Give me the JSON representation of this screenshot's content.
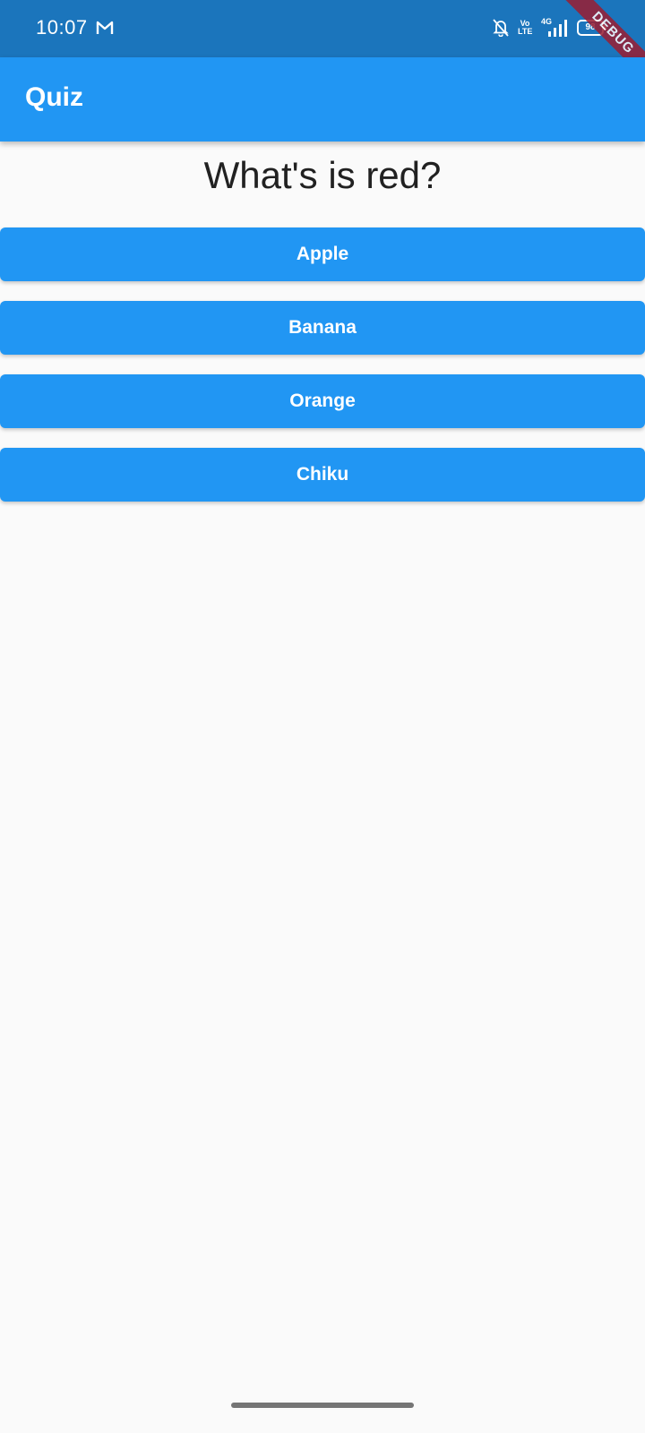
{
  "status_bar": {
    "time": "10:07",
    "volte": "Vo\nLTE",
    "network": "4G",
    "battery": "98",
    "background_color": "#1b75bc",
    "icons": [
      "gmail-icon",
      "bell-off-icon",
      "volte-icon",
      "signal-icon",
      "battery-icon"
    ]
  },
  "debug_banner": {
    "label": "DEBUG",
    "color": "#9a1d32"
  },
  "app_bar": {
    "title": "Quiz",
    "color": "#2196f3"
  },
  "quiz": {
    "question": "What's is red?",
    "answers": [
      {
        "label": "Apple"
      },
      {
        "label": "Banana"
      },
      {
        "label": "Orange"
      },
      {
        "label": "Chiku"
      }
    ]
  }
}
